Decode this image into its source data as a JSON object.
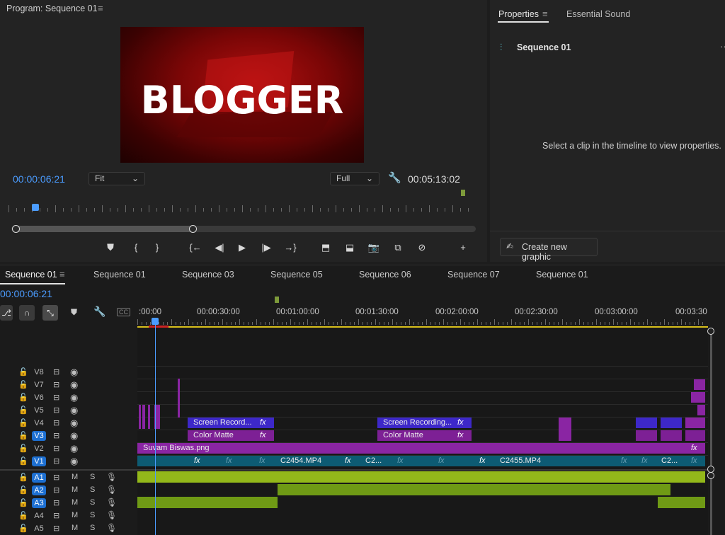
{
  "program": {
    "title": "Program: Sequence 01",
    "menu_icon": "hamburger-icon",
    "preview_text": "BLOGGER",
    "current_time": "00:00:06:21",
    "fit_label": "Fit",
    "quality_label": "Full",
    "duration": "00:05:13:02",
    "controls": [
      {
        "name": "add-marker-button",
        "glyph": "⛊"
      },
      {
        "name": "mark-in-button",
        "glyph": "{"
      },
      {
        "name": "mark-out-button",
        "glyph": "}"
      },
      {
        "name": "go-to-in-button",
        "glyph": "{←"
      },
      {
        "name": "step-back-button",
        "glyph": "◀|"
      },
      {
        "name": "play-button",
        "glyph": "▶"
      },
      {
        "name": "step-forward-button",
        "glyph": "|▶"
      },
      {
        "name": "go-to-out-button",
        "glyph": "→}"
      },
      {
        "name": "lift-button",
        "glyph": "⬒"
      },
      {
        "name": "extract-button",
        "glyph": "⬓"
      },
      {
        "name": "export-frame-button",
        "glyph": "📷"
      },
      {
        "name": "comparison-view-button",
        "glyph": "⧉"
      },
      {
        "name": "proxy-toggle-button",
        "glyph": "⊘"
      },
      {
        "name": "add-button",
        "glyph": "+"
      }
    ]
  },
  "properties": {
    "tab_properties": "Properties",
    "tab_essential_sound": "Essential Sound",
    "sequence_name": "Sequence 01",
    "empty_message": "Select a clip in the timeline to view properties.",
    "create_graphic": "Create new graphic"
  },
  "timeline": {
    "tabs": [
      "Sequence 01",
      "Sequence 01",
      "Sequence 03",
      "Sequence 05",
      "Sequence 06",
      "Sequence 07",
      "Sequence 01"
    ],
    "current_time": "00:00:06:21",
    "ruler": [
      ":00:00",
      "00:00:30:00",
      "00:01:00:00",
      "00:01:30:00",
      "00:02:00:00",
      "00:02:30:00",
      "00:03:00:00",
      "00:03:30"
    ],
    "video_tracks": [
      "V8",
      "V7",
      "V6",
      "V5",
      "V4",
      "V3",
      "V2",
      "V1"
    ],
    "audio_tracks": [
      "A1",
      "A2",
      "A3",
      "A4",
      "A5"
    ],
    "mute_label": "M",
    "solo_label": "S",
    "clips": {
      "screen_record_1": "Screen Record...",
      "screen_record_2": "Screen Recording...",
      "color_matte_1": "Color Matte",
      "color_matte_2": "Color Matte",
      "suvam": "Suvam Biswas.png",
      "c2454": "C2454.MP4",
      "c2_a": "C2...",
      "c2455": "C2455.MP4",
      "c2_b": "C2...",
      "fx": "fx"
    }
  },
  "colors": {
    "accent_blue": "#4b9cff",
    "track_on": "#1d6fd1",
    "purple_clip": "#8a25a3",
    "video_clip": "#0d5b73",
    "audio_clip": "#93b81a"
  }
}
